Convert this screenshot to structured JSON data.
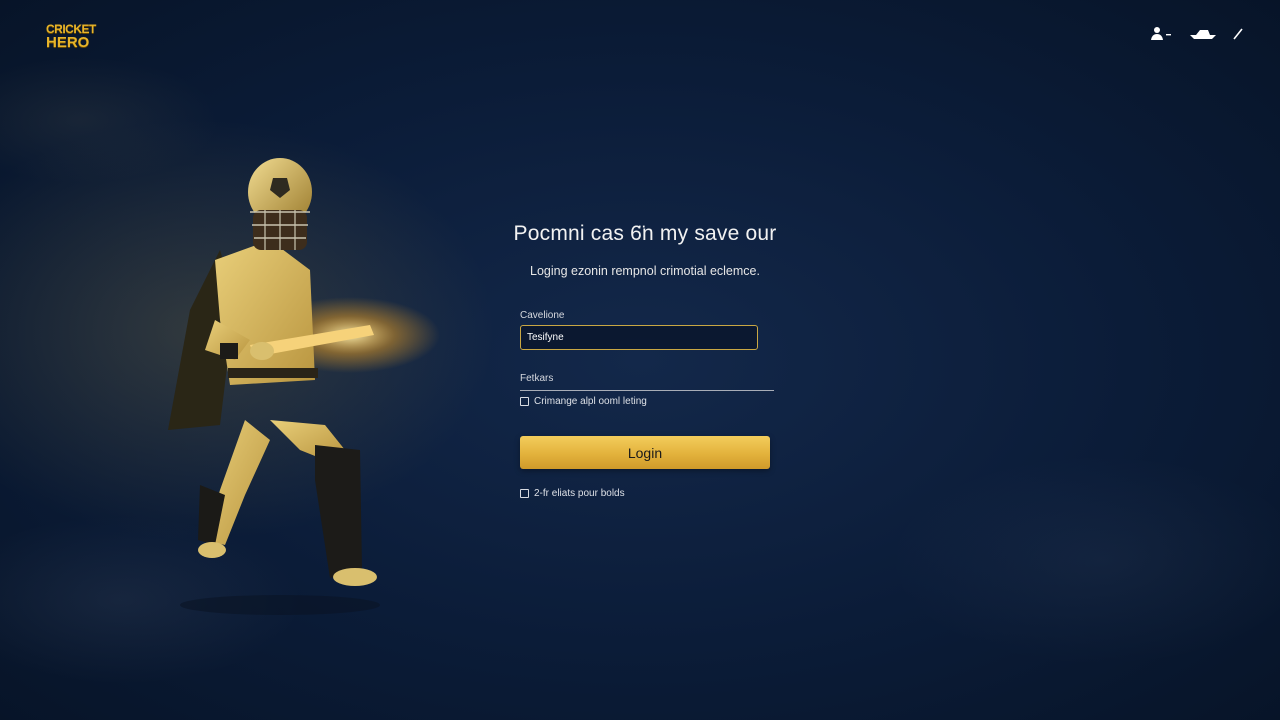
{
  "brand": {
    "logo_line1": "CRICKET",
    "logo_line2": "HERO"
  },
  "top_icons": [
    "person-icon",
    "boat-icon",
    "pen-icon"
  ],
  "login": {
    "headline": "Pocmni cas 6̈n my save our",
    "subline": "Loging ezonin rempnol crimotial eclemce.",
    "field1_label": "Cavelione",
    "field1_value": "Tesifyne",
    "field2_label": "Fetkars",
    "checkbox1_label": "Crimange alpl ooml leting",
    "button_label": "Login",
    "checkbox2_label": "2-fr eliats pour bolds"
  },
  "colors": {
    "accent_gold": "#e3b23c",
    "background_navy": "#0b1c38",
    "logo_gold": "#e7b42a"
  }
}
